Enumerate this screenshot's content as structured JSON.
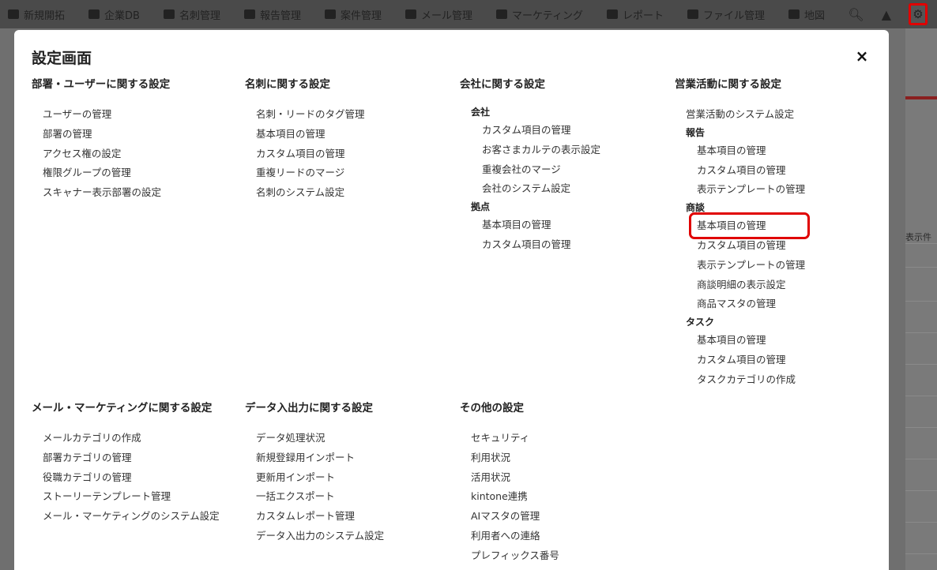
{
  "topnav": {
    "items": [
      "新規開拓",
      "企業DB",
      "名刺管理",
      "報告管理",
      "案件管理",
      "メール管理",
      "マーケティング",
      "レポート",
      "ファイル管理",
      "地図"
    ],
    "right_icons": [
      "search-icon",
      "bell-icon",
      "gear-icon"
    ]
  },
  "background": {
    "label": "表示件"
  },
  "modal": {
    "title": "設定画面",
    "close_icon": "×"
  },
  "sections": {
    "dept_user": {
      "heading": "部署・ユーザーに関する設定",
      "links": [
        "ユーザーの管理",
        "部署の管理",
        "アクセス権の設定",
        "権限グループの管理",
        "スキャナー表示部署の設定"
      ]
    },
    "card": {
      "heading": "名刺に関する設定",
      "links": [
        "名刺・リードのタグ管理",
        "基本項目の管理",
        "カスタム項目の管理",
        "重複リードのマージ",
        "名刺のシステム設定"
      ]
    },
    "company": {
      "heading": "会社に関する設定",
      "groups": [
        {
          "label": "会社",
          "links": [
            "カスタム項目の管理",
            "お客さまカルテの表示設定",
            "重複会社のマージ",
            "会社のシステム設定"
          ]
        },
        {
          "label": "拠点",
          "links": [
            "基本項目の管理",
            "カスタム項目の管理"
          ]
        }
      ]
    },
    "sales": {
      "heading": "営業活動に関する設定",
      "top_link": "営業活動のシステム設定",
      "groups": [
        {
          "label": "報告",
          "links": [
            "基本項目の管理",
            "カスタム項目の管理",
            "表示テンプレートの管理"
          ]
        },
        {
          "label": "商談",
          "links": [
            "基本項目の管理",
            "カスタム項目の管理",
            "表示テンプレートの管理",
            "商談明細の表示設定",
            "商品マスタの管理"
          ]
        },
        {
          "label": "タスク",
          "links": [
            "基本項目の管理",
            "カスタム項目の管理",
            "タスクカテゴリの作成"
          ]
        }
      ]
    },
    "mail": {
      "heading": "メール・マーケティングに関する設定",
      "links": [
        "メールカテゴリの作成",
        "部署カテゴリの管理",
        "役職カテゴリの管理",
        "ストーリーテンプレート管理",
        "メール・マーケティングのシステム設定"
      ]
    },
    "data_io": {
      "heading": "データ入出力に関する設定",
      "links": [
        "データ処理状況",
        "新規登録用インポート",
        "更新用インポート",
        "一括エクスポート",
        "カスタムレポート管理",
        "データ入出力のシステム設定"
      ]
    },
    "other": {
      "heading": "その他の設定",
      "links": [
        "セキュリティ",
        "利用状況",
        "活用状況",
        "kintone連携",
        "AIマスタの管理",
        "利用者への連絡",
        "プレフィックス番号"
      ]
    }
  },
  "colors": {
    "highlight": "#e00000",
    "overlay": "#6f6f6f"
  }
}
